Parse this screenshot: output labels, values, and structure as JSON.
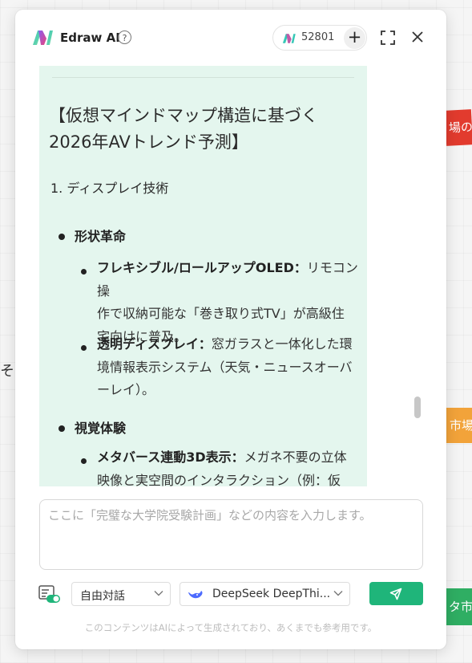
{
  "background": {
    "tags": {
      "red": "場の変",
      "orange": "市場",
      "green": "タ市"
    },
    "side_text": "その"
  },
  "header": {
    "app_title": "Edraw AI",
    "help_symbol": "?",
    "credits": "52801",
    "add_symbol": "+"
  },
  "content": {
    "heading_line1": "【仮想マインドマップ構造に基づく",
    "heading_line2": "2026年AVトレンド予測】",
    "section_title": "1. ディスプレイ技術",
    "groups": [
      {
        "title": "形状革命",
        "items": [
          {
            "label": "フレキシブル/ロールアップOLED：",
            "line1_rest": "リモコン操",
            "line2": "作で収納可能な「巻き取り式TV」が高級住",
            "line3": "宅向けに普及。"
          },
          {
            "label": "透明ディスプレイ：",
            "line1_rest": "窓ガラスと一体化した環",
            "line2": "境情報表示システム（天気・ニュースオーバ",
            "line3": "ーレイ）。"
          }
        ]
      },
      {
        "title": "視覚体験",
        "items": [
          {
            "label": "メタバース連動3D表示：",
            "line1_rest": "メガネ不要の立体",
            "line2": "映像と実空間のインタラクション（例：仮"
          }
        ]
      }
    ]
  },
  "input": {
    "placeholder": "ここに「完璧な大学院受験計画」などの内容を入力します。",
    "value": ""
  },
  "toolbar": {
    "mode_value": "自由対話",
    "model_value": "DeepSeek DeepThi..."
  },
  "disclaimer": "このコンテンツはAIによって生成されており、あくまでも参考用です。",
  "colors": {
    "accent": "#1fb57a",
    "content_bg": "#e4f6ee",
    "logo_pink": "#e8457d",
    "logo_teal": "#36c7b6"
  }
}
